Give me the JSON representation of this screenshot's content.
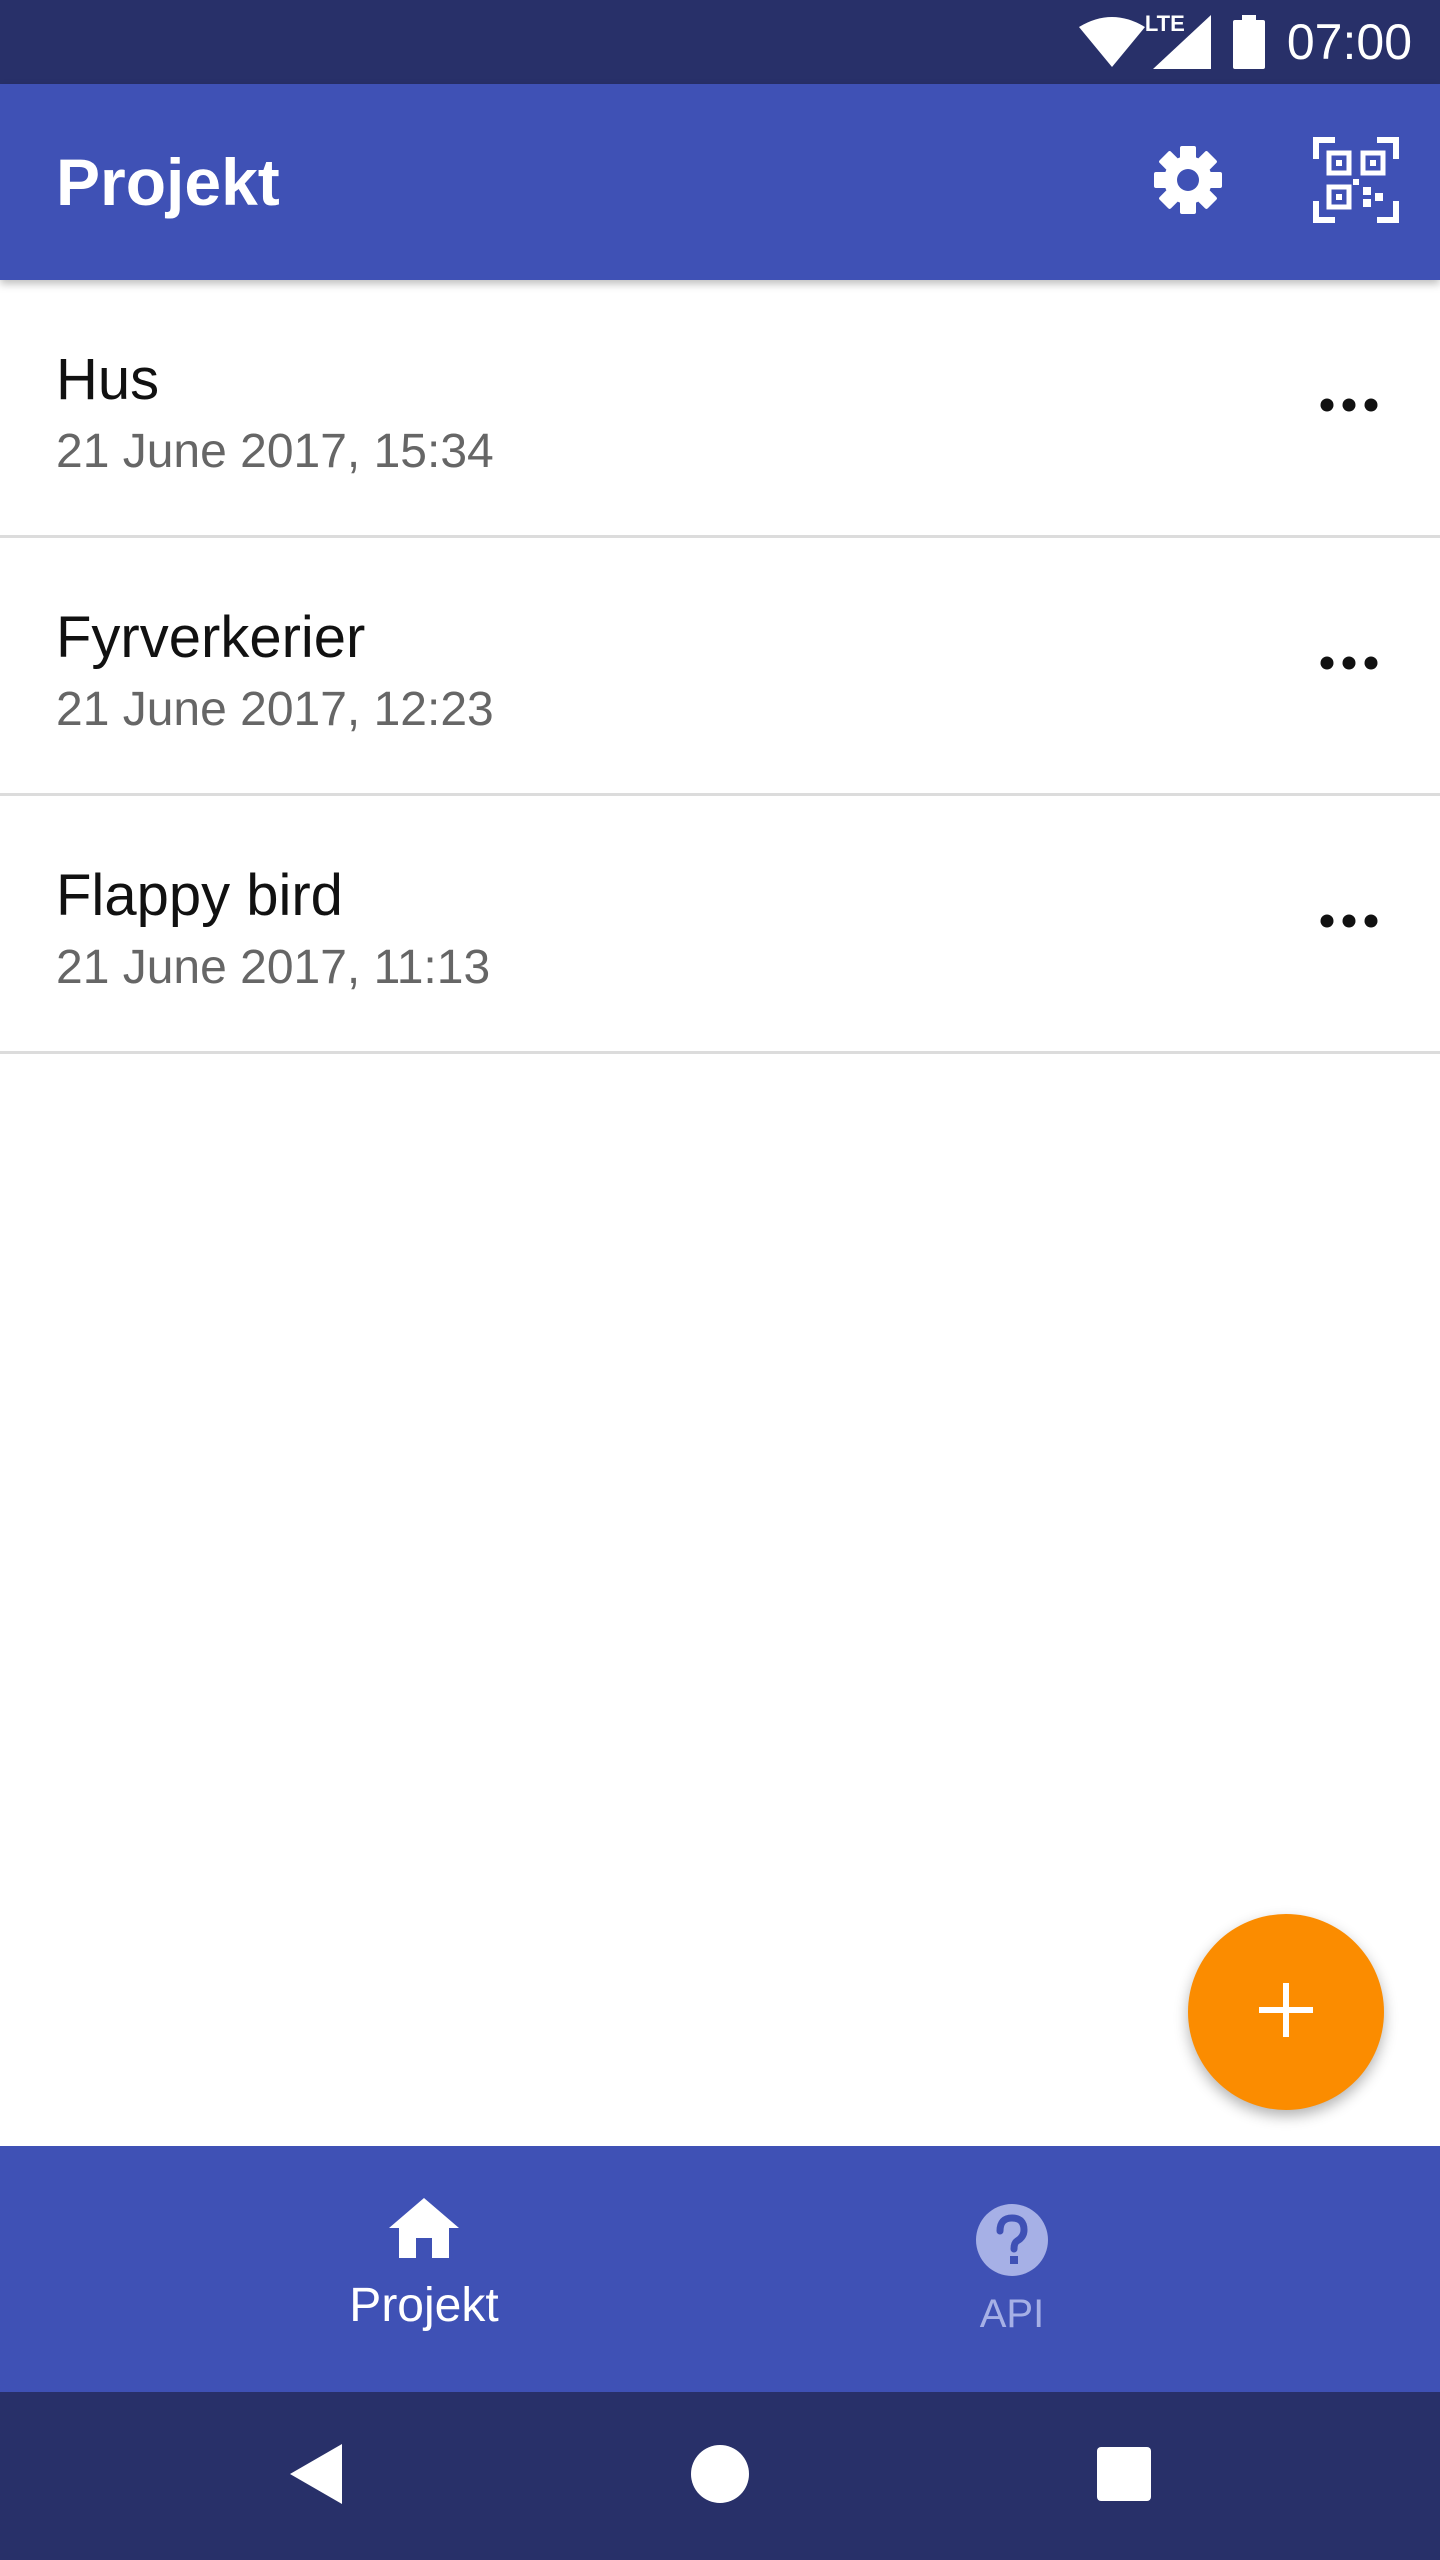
{
  "status_bar": {
    "time": "07:00",
    "network_label": "LTE",
    "icons": [
      "wifi-icon",
      "cellular-signal-icon",
      "battery-icon"
    ]
  },
  "app_bar": {
    "title": "Projekt",
    "actions": [
      "settings-icon",
      "qr-scanner-icon"
    ]
  },
  "projects": [
    {
      "title": "Hus",
      "date": "21 June 2017, 15:34"
    },
    {
      "title": "Fyrverkerier",
      "date": "21 June 2017, 12:23"
    },
    {
      "title": "Flappy bird",
      "date": "21 June 2017, 11:13"
    }
  ],
  "fab": {
    "icon": "plus-icon"
  },
  "bottom_nav": {
    "tabs": [
      {
        "label": "Projekt",
        "icon": "home-icon",
        "active": true
      },
      {
        "label": "API",
        "icon": "help-circle-icon",
        "active": false
      }
    ]
  },
  "system_nav": {
    "buttons": [
      "back-icon",
      "home-circle-icon",
      "recents-icon"
    ]
  },
  "colors": {
    "status_bar": "#283069",
    "app_bar": "#3f51b5",
    "fab": "#fb8c00",
    "divider": "#dcdcdc",
    "nav_inactive": "#a6b0e6"
  }
}
